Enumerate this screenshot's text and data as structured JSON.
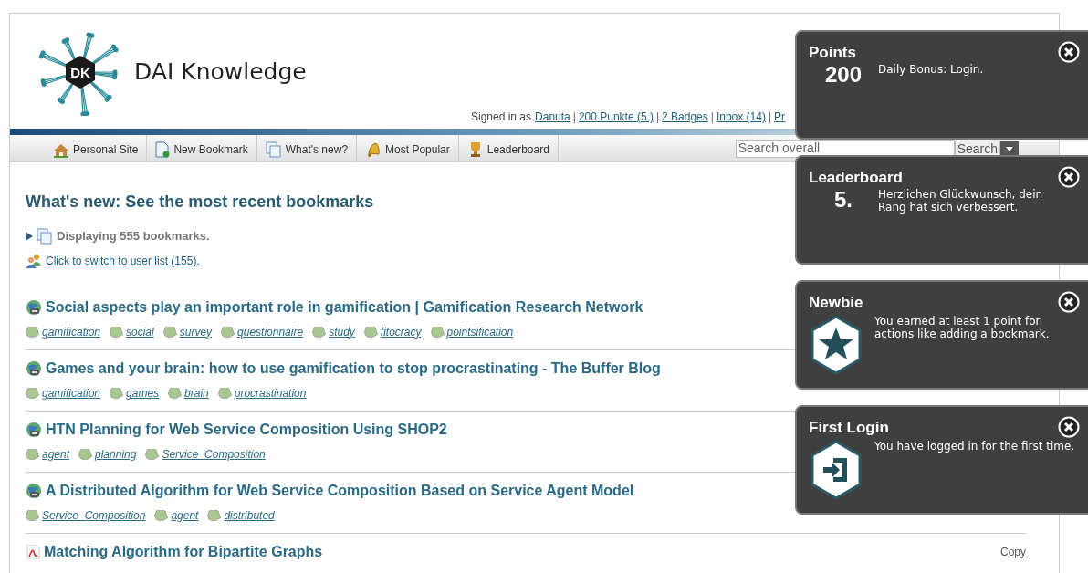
{
  "header": {
    "site_title": "DAI Knowledge",
    "logo_text": "DK",
    "signed_in_label": "Signed in as",
    "link_separator": "|",
    "user_links": [
      "Danuta",
      "200 Punkte (5.)",
      "2 Badges",
      "Inbox (14)",
      "Pr"
    ]
  },
  "nav": [
    {
      "label": "Personal Site",
      "kind": "house"
    },
    {
      "label": "New Bookmark",
      "kind": "page"
    },
    {
      "label": "What's new?",
      "kind": "pages"
    },
    {
      "label": "Most Popular",
      "kind": "bell"
    },
    {
      "label": "Leaderboard",
      "kind": "trophy"
    }
  ],
  "search": {
    "placeholder": "Search overall",
    "button": "Search"
  },
  "main": {
    "heading": "What's new: See the most recent bookmarks",
    "summary": "Displaying 555 bookmarks.",
    "switch_link": "Click to switch to user list (155).",
    "bookmarks": [
      {
        "kind": "web",
        "title": "Social aspects play an important role in gamification | Gamification Research Network",
        "tags": [
          "gamification",
          "social",
          "survey",
          "questionnaire",
          "study",
          "fitocracy",
          "pointsification"
        ]
      },
      {
        "kind": "web",
        "title": "Games and your brain: how to use gamification to stop procrastinating - The Buffer Blog",
        "tags": [
          "gamification",
          "games",
          "brain",
          "procrastination"
        ]
      },
      {
        "kind": "web",
        "title": "HTN Planning for Web Service Composition Using SHOP2",
        "tags": [
          "agent",
          "planning",
          "Service_Composition"
        ]
      },
      {
        "kind": "web",
        "title": "A Distributed Algorithm for Web Service Composition Based on Service Agent Model",
        "tags": [
          "Service_Composition",
          "agent",
          "distributed"
        ]
      },
      {
        "kind": "pdf",
        "title": "Matching Algorithm for Bipartite Graphs",
        "copy": "Copy"
      }
    ]
  },
  "notifications": [
    {
      "kind": "value",
      "title": "Points",
      "value": "200",
      "text": "Daily Bonus: Login."
    },
    {
      "kind": "value",
      "title": "Leaderboard",
      "value": "5.",
      "text": "Herzlichen Glückwunsch, dein Rang hat sich verbessert."
    },
    {
      "kind": "star_badge",
      "title": "Newbie",
      "text": "You earned at least 1 point for actions like adding a bookmark."
    },
    {
      "kind": "login_badge",
      "title": "First Login",
      "text": "You have logged in for the first time."
    }
  ]
}
